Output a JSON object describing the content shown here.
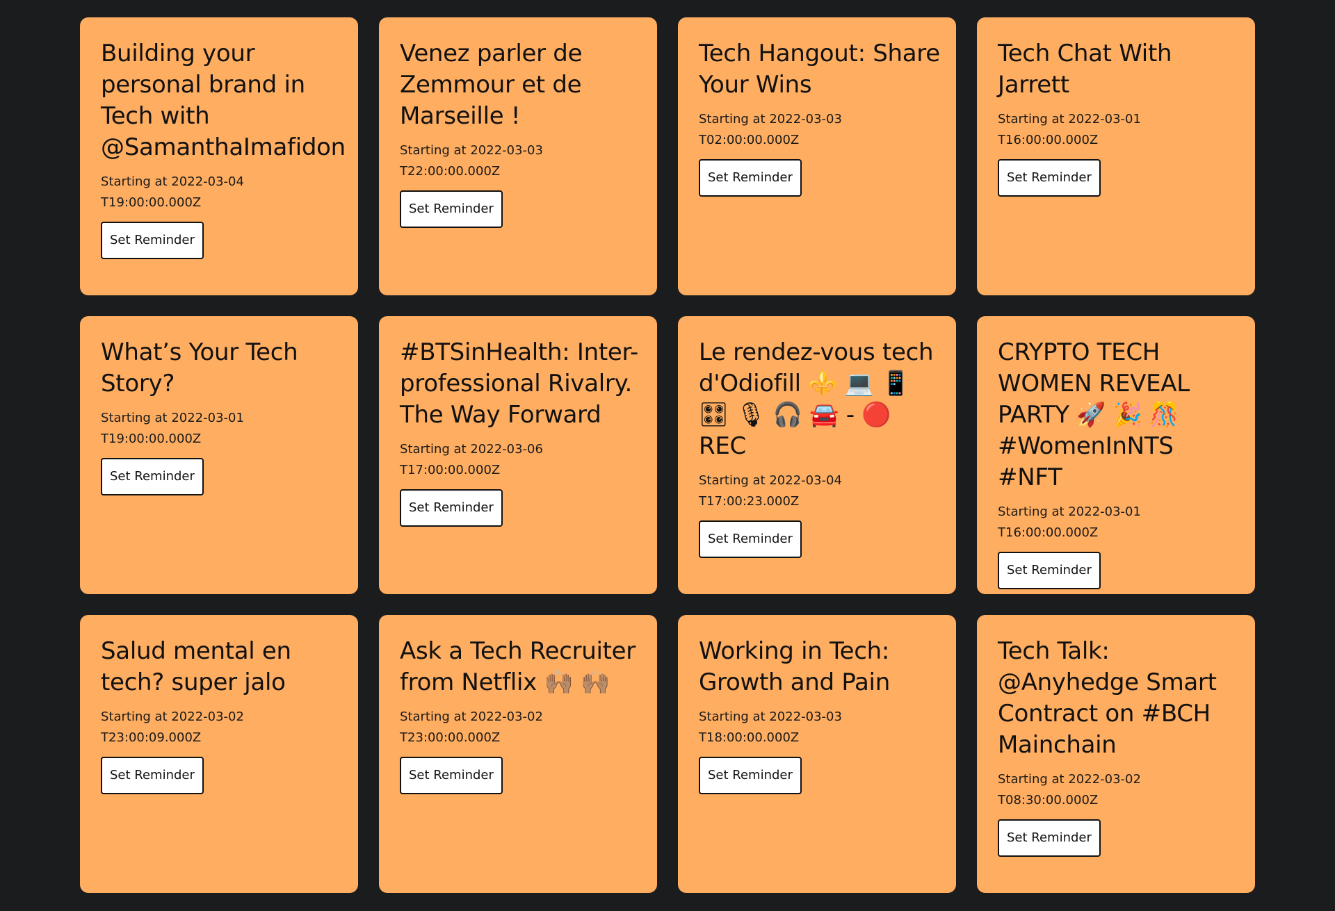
{
  "events": [
    {
      "title": "Building your personal brand in Tech with @SamanthaImafidon",
      "time": "Starting at 2022-03-04T19:00:00.000Z",
      "button": "Set Reminder"
    },
    {
      "title": "Venez parler de Zemmour et de Marseille !",
      "time": "Starting at 2022-03-03T22:00:00.000Z",
      "button": "Set Reminder"
    },
    {
      "title": "Tech Hangout: Share Your Wins",
      "time": "Starting at 2022-03-03T02:00:00.000Z",
      "button": "Set Reminder"
    },
    {
      "title": "Tech Chat With Jarrett",
      "time": "Starting at 2022-03-01T16:00:00.000Z",
      "button": "Set Reminder"
    },
    {
      "title": "What’s Your Tech Story?",
      "time": "Starting at 2022-03-01T19:00:00.000Z",
      "button": "Set Reminder"
    },
    {
      "title": "#BTSinHealth: Inter-professional Rivalry. The Way Forward",
      "time": "Starting at 2022-03-06T17:00:00.000Z",
      "button": "Set Reminder"
    },
    {
      "title": "Le rendez-vous tech d'Odiofill ⚜️ 💻 📱 🎛 🎙 🎧 🚘 - 🔴 REC",
      "time": "Starting at 2022-03-04T17:00:23.000Z",
      "button": "Set Reminder"
    },
    {
      "title": "CRYPTO TECH WOMEN REVEAL PARTY 🚀 🎉 🎊 #WomenInNTS #NFT",
      "time": "Starting at 2022-03-01T16:00:00.000Z",
      "button": "Set Reminder"
    },
    {
      "title": "Salud mental en tech? super jalo",
      "time": "Starting at 2022-03-02T23:00:09.000Z",
      "button": "Set Reminder"
    },
    {
      "title": "Ask a Tech Recruiter from Netflix 🙌🏽 🙌🏽",
      "time": "Starting at 2022-03-02T23:00:00.000Z",
      "button": "Set Reminder"
    },
    {
      "title": "Working in Tech: Growth and Pain",
      "time": "Starting at 2022-03-03T18:00:00.000Z",
      "button": "Set Reminder"
    },
    {
      "title": "Tech Talk: @Anyhedge Smart Contract on #BCH Mainchain",
      "time": "Starting at 2022-03-02T08:30:00.000Z",
      "button": "Set Reminder"
    }
  ],
  "colors": {
    "background": "#1b1c1e",
    "card": "#ffad60",
    "button_bg": "#ffffff",
    "button_border": "#111111"
  }
}
